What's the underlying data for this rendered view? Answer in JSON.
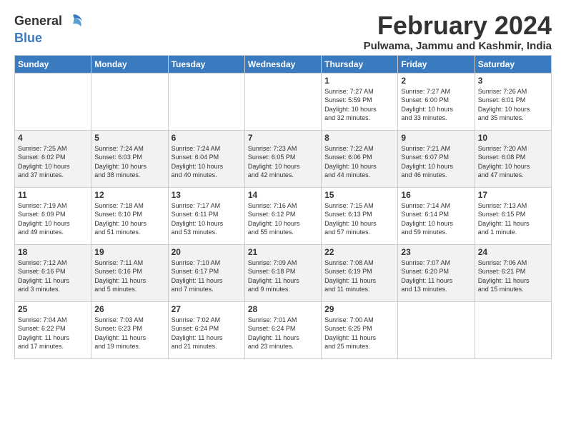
{
  "header": {
    "logo_general": "General",
    "logo_blue": "Blue",
    "title": "February 2024",
    "subtitle": "Pulwama, Jammu and Kashmir, India"
  },
  "days_of_week": [
    "Sunday",
    "Monday",
    "Tuesday",
    "Wednesday",
    "Thursday",
    "Friday",
    "Saturday"
  ],
  "weeks": [
    [
      {
        "day": "",
        "info": ""
      },
      {
        "day": "",
        "info": ""
      },
      {
        "day": "",
        "info": ""
      },
      {
        "day": "",
        "info": ""
      },
      {
        "day": "1",
        "info": "Sunrise: 7:27 AM\nSunset: 5:59 PM\nDaylight: 10 hours\nand 32 minutes."
      },
      {
        "day": "2",
        "info": "Sunrise: 7:27 AM\nSunset: 6:00 PM\nDaylight: 10 hours\nand 33 minutes."
      },
      {
        "day": "3",
        "info": "Sunrise: 7:26 AM\nSunset: 6:01 PM\nDaylight: 10 hours\nand 35 minutes."
      }
    ],
    [
      {
        "day": "4",
        "info": "Sunrise: 7:25 AM\nSunset: 6:02 PM\nDaylight: 10 hours\nand 37 minutes."
      },
      {
        "day": "5",
        "info": "Sunrise: 7:24 AM\nSunset: 6:03 PM\nDaylight: 10 hours\nand 38 minutes."
      },
      {
        "day": "6",
        "info": "Sunrise: 7:24 AM\nSunset: 6:04 PM\nDaylight: 10 hours\nand 40 minutes."
      },
      {
        "day": "7",
        "info": "Sunrise: 7:23 AM\nSunset: 6:05 PM\nDaylight: 10 hours\nand 42 minutes."
      },
      {
        "day": "8",
        "info": "Sunrise: 7:22 AM\nSunset: 6:06 PM\nDaylight: 10 hours\nand 44 minutes."
      },
      {
        "day": "9",
        "info": "Sunrise: 7:21 AM\nSunset: 6:07 PM\nDaylight: 10 hours\nand 46 minutes."
      },
      {
        "day": "10",
        "info": "Sunrise: 7:20 AM\nSunset: 6:08 PM\nDaylight: 10 hours\nand 47 minutes."
      }
    ],
    [
      {
        "day": "11",
        "info": "Sunrise: 7:19 AM\nSunset: 6:09 PM\nDaylight: 10 hours\nand 49 minutes."
      },
      {
        "day": "12",
        "info": "Sunrise: 7:18 AM\nSunset: 6:10 PM\nDaylight: 10 hours\nand 51 minutes."
      },
      {
        "day": "13",
        "info": "Sunrise: 7:17 AM\nSunset: 6:11 PM\nDaylight: 10 hours\nand 53 minutes."
      },
      {
        "day": "14",
        "info": "Sunrise: 7:16 AM\nSunset: 6:12 PM\nDaylight: 10 hours\nand 55 minutes."
      },
      {
        "day": "15",
        "info": "Sunrise: 7:15 AM\nSunset: 6:13 PM\nDaylight: 10 hours\nand 57 minutes."
      },
      {
        "day": "16",
        "info": "Sunrise: 7:14 AM\nSunset: 6:14 PM\nDaylight: 10 hours\nand 59 minutes."
      },
      {
        "day": "17",
        "info": "Sunrise: 7:13 AM\nSunset: 6:15 PM\nDaylight: 11 hours\nand 1 minute."
      }
    ],
    [
      {
        "day": "18",
        "info": "Sunrise: 7:12 AM\nSunset: 6:16 PM\nDaylight: 11 hours\nand 3 minutes."
      },
      {
        "day": "19",
        "info": "Sunrise: 7:11 AM\nSunset: 6:16 PM\nDaylight: 11 hours\nand 5 minutes."
      },
      {
        "day": "20",
        "info": "Sunrise: 7:10 AM\nSunset: 6:17 PM\nDaylight: 11 hours\nand 7 minutes."
      },
      {
        "day": "21",
        "info": "Sunrise: 7:09 AM\nSunset: 6:18 PM\nDaylight: 11 hours\nand 9 minutes."
      },
      {
        "day": "22",
        "info": "Sunrise: 7:08 AM\nSunset: 6:19 PM\nDaylight: 11 hours\nand 11 minutes."
      },
      {
        "day": "23",
        "info": "Sunrise: 7:07 AM\nSunset: 6:20 PM\nDaylight: 11 hours\nand 13 minutes."
      },
      {
        "day": "24",
        "info": "Sunrise: 7:06 AM\nSunset: 6:21 PM\nDaylight: 11 hours\nand 15 minutes."
      }
    ],
    [
      {
        "day": "25",
        "info": "Sunrise: 7:04 AM\nSunset: 6:22 PM\nDaylight: 11 hours\nand 17 minutes."
      },
      {
        "day": "26",
        "info": "Sunrise: 7:03 AM\nSunset: 6:23 PM\nDaylight: 11 hours\nand 19 minutes."
      },
      {
        "day": "27",
        "info": "Sunrise: 7:02 AM\nSunset: 6:24 PM\nDaylight: 11 hours\nand 21 minutes."
      },
      {
        "day": "28",
        "info": "Sunrise: 7:01 AM\nSunset: 6:24 PM\nDaylight: 11 hours\nand 23 minutes."
      },
      {
        "day": "29",
        "info": "Sunrise: 7:00 AM\nSunset: 6:25 PM\nDaylight: 11 hours\nand 25 minutes."
      },
      {
        "day": "",
        "info": ""
      },
      {
        "day": "",
        "info": ""
      }
    ]
  ]
}
